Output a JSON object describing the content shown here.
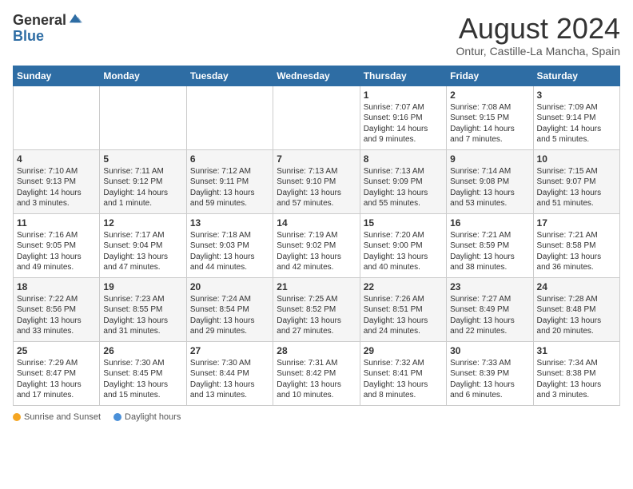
{
  "header": {
    "logo_general": "General",
    "logo_blue": "Blue",
    "title": "August 2024",
    "subtitle": "Ontur, Castille-La Mancha, Spain"
  },
  "days_of_week": [
    "Sunday",
    "Monday",
    "Tuesday",
    "Wednesday",
    "Thursday",
    "Friday",
    "Saturday"
  ],
  "weeks": [
    [
      {
        "day": "",
        "content": ""
      },
      {
        "day": "",
        "content": ""
      },
      {
        "day": "",
        "content": ""
      },
      {
        "day": "",
        "content": ""
      },
      {
        "day": "1",
        "content": "Sunrise: 7:07 AM\nSunset: 9:16 PM\nDaylight: 14 hours and 9 minutes."
      },
      {
        "day": "2",
        "content": "Sunrise: 7:08 AM\nSunset: 9:15 PM\nDaylight: 14 hours and 7 minutes."
      },
      {
        "day": "3",
        "content": "Sunrise: 7:09 AM\nSunset: 9:14 PM\nDaylight: 14 hours and 5 minutes."
      }
    ],
    [
      {
        "day": "4",
        "content": "Sunrise: 7:10 AM\nSunset: 9:13 PM\nDaylight: 14 hours and 3 minutes."
      },
      {
        "day": "5",
        "content": "Sunrise: 7:11 AM\nSunset: 9:12 PM\nDaylight: 14 hours and 1 minute."
      },
      {
        "day": "6",
        "content": "Sunrise: 7:12 AM\nSunset: 9:11 PM\nDaylight: 13 hours and 59 minutes."
      },
      {
        "day": "7",
        "content": "Sunrise: 7:13 AM\nSunset: 9:10 PM\nDaylight: 13 hours and 57 minutes."
      },
      {
        "day": "8",
        "content": "Sunrise: 7:13 AM\nSunset: 9:09 PM\nDaylight: 13 hours and 55 minutes."
      },
      {
        "day": "9",
        "content": "Sunrise: 7:14 AM\nSunset: 9:08 PM\nDaylight: 13 hours and 53 minutes."
      },
      {
        "day": "10",
        "content": "Sunrise: 7:15 AM\nSunset: 9:07 PM\nDaylight: 13 hours and 51 minutes."
      }
    ],
    [
      {
        "day": "11",
        "content": "Sunrise: 7:16 AM\nSunset: 9:05 PM\nDaylight: 13 hours and 49 minutes."
      },
      {
        "day": "12",
        "content": "Sunrise: 7:17 AM\nSunset: 9:04 PM\nDaylight: 13 hours and 47 minutes."
      },
      {
        "day": "13",
        "content": "Sunrise: 7:18 AM\nSunset: 9:03 PM\nDaylight: 13 hours and 44 minutes."
      },
      {
        "day": "14",
        "content": "Sunrise: 7:19 AM\nSunset: 9:02 PM\nDaylight: 13 hours and 42 minutes."
      },
      {
        "day": "15",
        "content": "Sunrise: 7:20 AM\nSunset: 9:00 PM\nDaylight: 13 hours and 40 minutes."
      },
      {
        "day": "16",
        "content": "Sunrise: 7:21 AM\nSunset: 8:59 PM\nDaylight: 13 hours and 38 minutes."
      },
      {
        "day": "17",
        "content": "Sunrise: 7:21 AM\nSunset: 8:58 PM\nDaylight: 13 hours and 36 minutes."
      }
    ],
    [
      {
        "day": "18",
        "content": "Sunrise: 7:22 AM\nSunset: 8:56 PM\nDaylight: 13 hours and 33 minutes."
      },
      {
        "day": "19",
        "content": "Sunrise: 7:23 AM\nSunset: 8:55 PM\nDaylight: 13 hours and 31 minutes."
      },
      {
        "day": "20",
        "content": "Sunrise: 7:24 AM\nSunset: 8:54 PM\nDaylight: 13 hours and 29 minutes."
      },
      {
        "day": "21",
        "content": "Sunrise: 7:25 AM\nSunset: 8:52 PM\nDaylight: 13 hours and 27 minutes."
      },
      {
        "day": "22",
        "content": "Sunrise: 7:26 AM\nSunset: 8:51 PM\nDaylight: 13 hours and 24 minutes."
      },
      {
        "day": "23",
        "content": "Sunrise: 7:27 AM\nSunset: 8:49 PM\nDaylight: 13 hours and 22 minutes."
      },
      {
        "day": "24",
        "content": "Sunrise: 7:28 AM\nSunset: 8:48 PM\nDaylight: 13 hours and 20 minutes."
      }
    ],
    [
      {
        "day": "25",
        "content": "Sunrise: 7:29 AM\nSunset: 8:47 PM\nDaylight: 13 hours and 17 minutes."
      },
      {
        "day": "26",
        "content": "Sunrise: 7:30 AM\nSunset: 8:45 PM\nDaylight: 13 hours and 15 minutes."
      },
      {
        "day": "27",
        "content": "Sunrise: 7:30 AM\nSunset: 8:44 PM\nDaylight: 13 hours and 13 minutes."
      },
      {
        "day": "28",
        "content": "Sunrise: 7:31 AM\nSunset: 8:42 PM\nDaylight: 13 hours and 10 minutes."
      },
      {
        "day": "29",
        "content": "Sunrise: 7:32 AM\nSunset: 8:41 PM\nDaylight: 13 hours and 8 minutes."
      },
      {
        "day": "30",
        "content": "Sunrise: 7:33 AM\nSunset: 8:39 PM\nDaylight: 13 hours and 6 minutes."
      },
      {
        "day": "31",
        "content": "Sunrise: 7:34 AM\nSunset: 8:38 PM\nDaylight: 13 hours and 3 minutes."
      }
    ]
  ],
  "legend": {
    "sunrise_label": "Sunrise and Sunset",
    "daylight_label": "Daylight hours"
  }
}
